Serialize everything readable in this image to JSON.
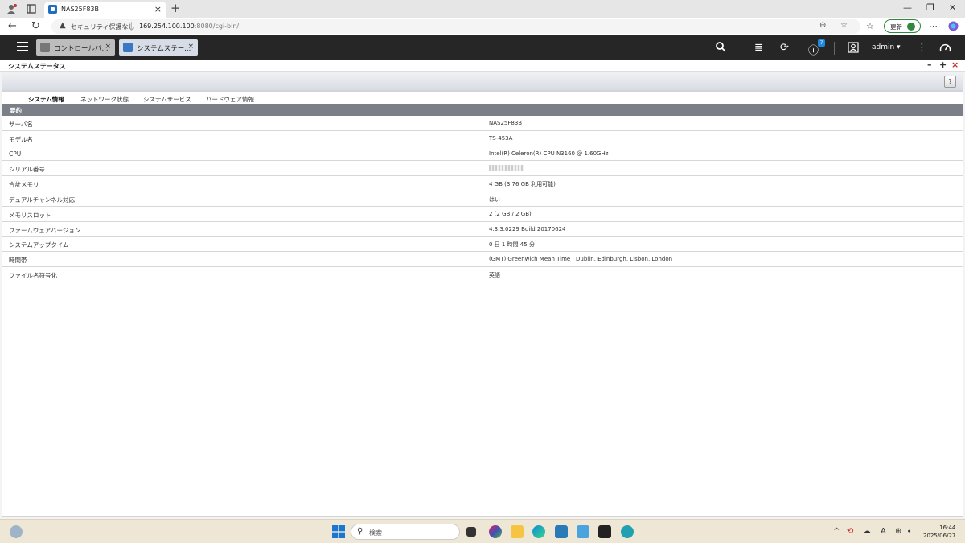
{
  "browser": {
    "tab_title": "NAS25F83B",
    "security_label": "セキュリティ保護なし",
    "url_host": "169.254.100.100",
    "url_rest": ":8080/cgi-bin/",
    "update_label": "更新"
  },
  "app": {
    "tabs": [
      {
        "label": "コントロールパ..."
      },
      {
        "label": "システムステー..."
      }
    ],
    "notification_count": "7",
    "user": "admin ▾"
  },
  "window": {
    "title": "システムステータス",
    "help": "?"
  },
  "subtabs": [
    {
      "label": "システム情報"
    },
    {
      "label": "ネットワーク状態"
    },
    {
      "label": "システムサービス"
    },
    {
      "label": "ハードウェア情報"
    }
  ],
  "summary": {
    "header": "要約",
    "rows": [
      {
        "key": "サーバ名",
        "value": "NAS25F83B"
      },
      {
        "key": "モデル名",
        "value": "TS-453A"
      },
      {
        "key": "CPU",
        "value": "Intel(R) Celeron(R) CPU N3160 @ 1.60GHz"
      },
      {
        "key": "シリアル番号",
        "value": ""
      },
      {
        "key": "合計メモリ",
        "value": "4 GB (3.76 GB 利用可能)"
      },
      {
        "key": "デュアルチャンネル対応",
        "value": "はい"
      },
      {
        "key": "メモリスロット",
        "value": "2 (2 GB / 2 GB)"
      },
      {
        "key": "ファームウェアバージョン",
        "value": "4.3.3.0229 Build 20170624"
      },
      {
        "key": "システムアップタイム",
        "value": "0 日 1 時間 45 分"
      },
      {
        "key": "時間帯",
        "value": "(GMT) Greenwich Mean Time : Dublin, Edinburgh, Lisbon, London"
      },
      {
        "key": "ファイル名符号化",
        "value": "英語"
      }
    ]
  },
  "taskbar": {
    "search_placeholder": "検索",
    "time": "16:44",
    "date": "2025/06/27"
  }
}
